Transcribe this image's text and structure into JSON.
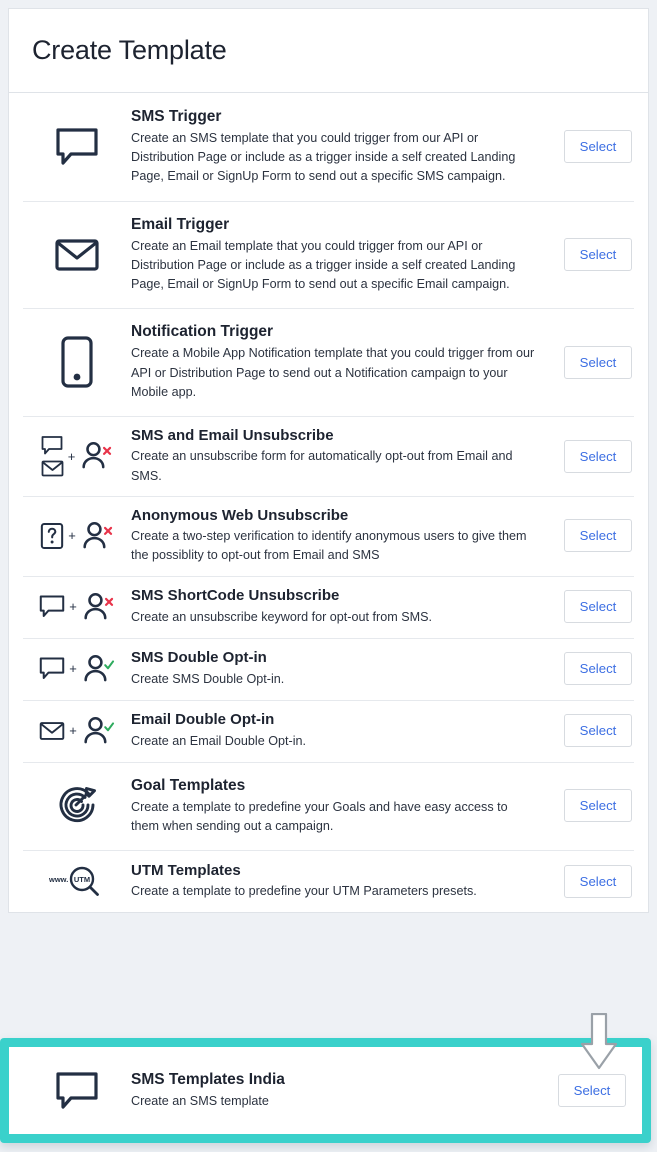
{
  "header": {
    "title": "Create Template"
  },
  "common": {
    "select_label": "Select",
    "plus_symbol": "+"
  },
  "colors": {
    "accent_link": "#3d6fe3",
    "highlight_teal": "#3ad1cb",
    "icon_dark": "#232f43",
    "marker_red": "#e8344a",
    "marker_green": "#2eab5e",
    "page_background": "#eef1f5",
    "card_border": "#dfe3e8"
  },
  "items": [
    {
      "title": "SMS Trigger",
      "description": "Create an SMS template that you could trigger from our API or Distribution Page or include as a trigger inside a self created Landing Page, Email or SignUp Form to send out a specific SMS campaign.",
      "icons": [
        "speech-bubble-icon"
      ],
      "select_label": "Select"
    },
    {
      "title": "Email Trigger",
      "description": "Create an Email template that you could trigger from our API or Distribution Page or include as a trigger inside a self created Landing Page, Email or SignUp Form to send out a specific Email campaign.",
      "icons": [
        "envelope-icon"
      ],
      "select_label": "Select"
    },
    {
      "title": "Notification Trigger",
      "description": "Create a Mobile App Notification template that you could trigger from our API or Distribution Page to send out a Notification campaign to your Mobile app.",
      "icons": [
        "mobile-phone-icon"
      ],
      "select_label": "Select"
    },
    {
      "title": "SMS and Email Unsubscribe",
      "description": "Create an unsubscribe form for automatically opt-out from Email and SMS.",
      "icons": [
        "speech-bubble-icon",
        "envelope-icon",
        "plus-symbol",
        "person-remove-icon"
      ],
      "select_label": "Select"
    },
    {
      "title": "Anonymous Web Unsubscribe",
      "description": "Create a two-step verification to identify anonymous users to give them the possiblity to opt-out from Email and SMS",
      "icons": [
        "anonymous-question-icon",
        "plus-symbol",
        "person-remove-icon"
      ],
      "select_label": "Select"
    },
    {
      "title": "SMS ShortCode Unsubscribe",
      "description": "Create an unsubscribe keyword for opt-out from SMS.",
      "icons": [
        "speech-bubble-icon",
        "plus-symbol",
        "person-remove-icon"
      ],
      "select_label": "Select"
    },
    {
      "title": "SMS Double Opt-in",
      "description": "Create SMS Double Opt-in.",
      "icons": [
        "speech-bubble-icon",
        "plus-symbol",
        "person-check-icon"
      ],
      "select_label": "Select"
    },
    {
      "title": "Email Double Opt-in",
      "description": "Create an Email Double Opt-in.",
      "icons": [
        "envelope-icon",
        "plus-symbol",
        "person-check-icon"
      ],
      "select_label": "Select"
    },
    {
      "title": "Goal Templates",
      "description": "Create a template to predefine your Goals and have easy access to them when sending out a campaign.",
      "icons": [
        "target-goal-icon"
      ],
      "select_label": "Select"
    },
    {
      "title": "UTM Templates",
      "description": "Create a template to predefine your UTM Parameters presets.",
      "icons": [
        "utm-magnifier-icon"
      ],
      "select_label": "Select"
    }
  ],
  "highlighted_item": {
    "title": "SMS Templates India",
    "description": "Create an SMS template",
    "icons": [
      "speech-bubble-icon"
    ],
    "select_label": "Select"
  }
}
